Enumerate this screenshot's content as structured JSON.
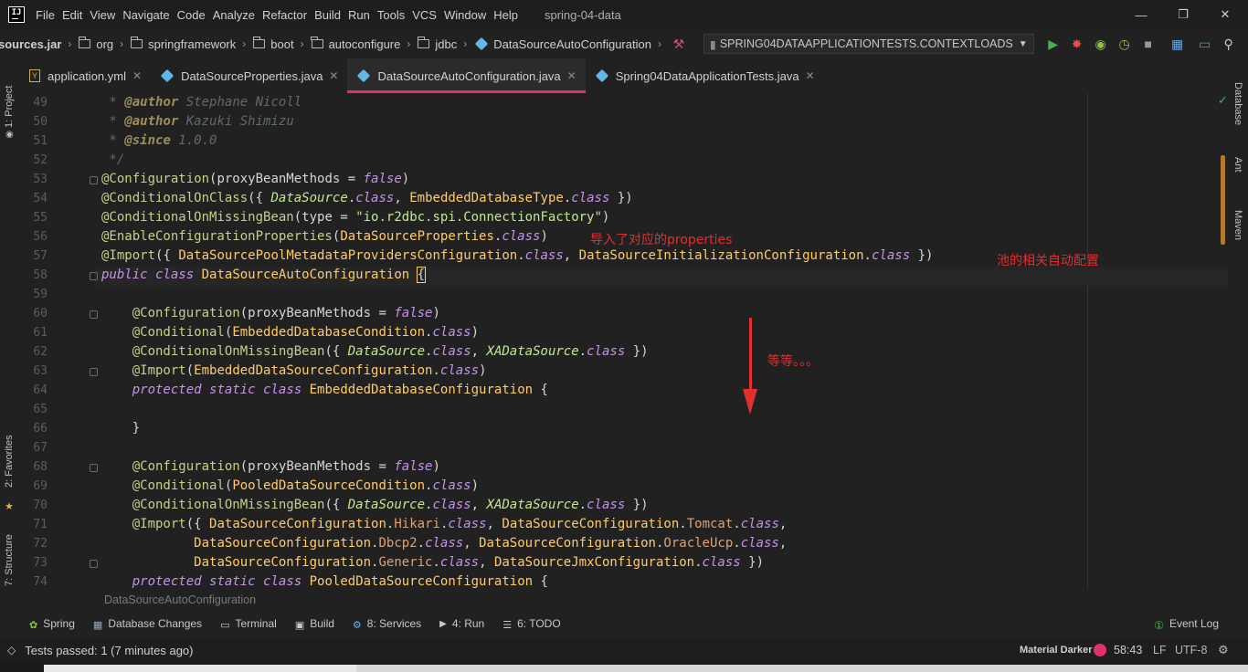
{
  "menu": {
    "items": [
      "File",
      "Edit",
      "View",
      "Navigate",
      "Code",
      "Analyze",
      "Refactor",
      "Build",
      "Run",
      "Tools",
      "VCS",
      "Window",
      "Help"
    ],
    "window_title": "spring-04-data"
  },
  "navbar": {
    "crumbs": [
      "sources.jar",
      "org",
      "springframework",
      "boot",
      "autoconfigure",
      "jdbc",
      "DataSourceAutoConfiguration"
    ],
    "run_config": "SPRING04DATAAPPLICATIONTESTS.CONTEXTLOADS"
  },
  "tabs": [
    {
      "label": "application.yml",
      "active": false
    },
    {
      "label": "DataSourceProperties.java",
      "active": false
    },
    {
      "label": "DataSourceAutoConfiguration.java",
      "active": true
    },
    {
      "label": "Spring04DataApplicationTests.java",
      "active": false
    }
  ],
  "left_strip": {
    "project": "1: Project",
    "favorites": "2: Favorites",
    "structure": "7: Structure"
  },
  "right_strip": {
    "database": "Database",
    "ant": "Ant",
    "maven": "Maven"
  },
  "editor": {
    "current_line": 58,
    "lines": [
      {
        "n": 49,
        "text": " * @author Stephane Nicoll"
      },
      {
        "n": 50,
        "text": " * @author Kazuki Shimizu"
      },
      {
        "n": 51,
        "text": " * @since 1.0.0"
      },
      {
        "n": 52,
        "text": " */"
      },
      {
        "n": 53,
        "text": "@Configuration(proxyBeanMethods = false)"
      },
      {
        "n": 54,
        "text": "@ConditionalOnClass({ DataSource.class, EmbeddedDatabaseType.class })"
      },
      {
        "n": 55,
        "text": "@ConditionalOnMissingBean(type = \"io.r2dbc.spi.ConnectionFactory\")"
      },
      {
        "n": 56,
        "text": "@EnableConfigurationProperties(DataSourceProperties.class)"
      },
      {
        "n": 57,
        "text": "@Import({ DataSourcePoolMetadataProvidersConfiguration.class, DataSourceInitializationConfiguration.class })"
      },
      {
        "n": 58,
        "text": "public class DataSourceAutoConfiguration {"
      },
      {
        "n": 59,
        "text": ""
      },
      {
        "n": 60,
        "text": "    @Configuration(proxyBeanMethods = false)"
      },
      {
        "n": 61,
        "text": "    @Conditional(EmbeddedDatabaseCondition.class)"
      },
      {
        "n": 62,
        "text": "    @ConditionalOnMissingBean({ DataSource.class, XADataSource.class })"
      },
      {
        "n": 63,
        "text": "    @Import(EmbeddedDataSourceConfiguration.class)"
      },
      {
        "n": 64,
        "text": "    protected static class EmbeddedDatabaseConfiguration {"
      },
      {
        "n": 65,
        "text": ""
      },
      {
        "n": 66,
        "text": "    }"
      },
      {
        "n": 67,
        "text": ""
      },
      {
        "n": 68,
        "text": "    @Configuration(proxyBeanMethods = false)"
      },
      {
        "n": 69,
        "text": "    @Conditional(PooledDataSourceCondition.class)"
      },
      {
        "n": 70,
        "text": "    @ConditionalOnMissingBean({ DataSource.class, XADataSource.class })"
      },
      {
        "n": 71,
        "text": "    @Import({ DataSourceConfiguration.Hikari.class, DataSourceConfiguration.Tomcat.class,"
      },
      {
        "n": 72,
        "text": "            DataSourceConfiguration.Dbcp2.class, DataSourceConfiguration.OracleUcp.class,"
      },
      {
        "n": 73,
        "text": "            DataSourceConfiguration.Generic.class, DataSourceJmxConfiguration.class })"
      },
      {
        "n": 74,
        "text": "    protected static class PooledDataSourceConfiguration {"
      }
    ]
  },
  "annotations": {
    "properties_note": "导入了对应的properties",
    "pool_note": "池的相关自动配置",
    "etc_note": "等等。。。"
  },
  "editor_breadcrumb": "DataSourceAutoConfiguration",
  "tool_windows": [
    {
      "label": "Spring"
    },
    {
      "label": "Database Changes"
    },
    {
      "label": "Terminal"
    },
    {
      "label": "Build"
    },
    {
      "label": "8: Services"
    },
    {
      "label": "4: Run"
    },
    {
      "label": "6: TODO"
    }
  ],
  "event_log": "Event Log",
  "status": {
    "message": "Tests passed: 1 (7 minutes ago)",
    "theme": "Material Darker",
    "position": "58:43",
    "line_sep": "LF",
    "encoding": "UTF-8"
  },
  "colors": {
    "accent_tab": "#e03070",
    "annotation_red": "#e03030",
    "keyword": "#c792ea",
    "class": "#ffcb6b",
    "interface": "#c3e88d"
  }
}
